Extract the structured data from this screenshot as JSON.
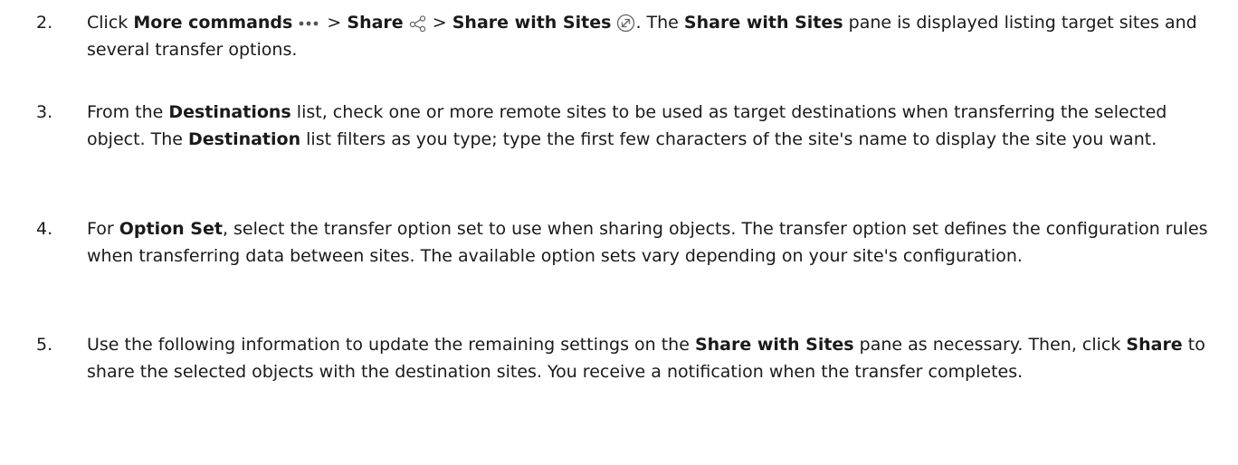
{
  "steps": [
    {
      "number": "2.",
      "t1": "Click ",
      "b1": "More commands",
      "t2": " > ",
      "b2": "Share",
      "t3": " > ",
      "b3": "Share with Sites",
      "t4": ". The ",
      "b4": "Share with Sites",
      "t5": " pane is displayed listing target sites and several transfer options.",
      "icons": [
        "more-commands-icon",
        "share-icon",
        "share-with-sites-icon"
      ]
    },
    {
      "number": "3.",
      "t1": "From the ",
      "b1": "Destinations",
      "t2": " list, check one or more remote sites to be used as target destinations when transferring the selected object. The ",
      "b2": "Destination",
      "t3": " list filters as you type; type the first few characters of the site's name to display the site you want."
    },
    {
      "number": "4.",
      "t1": "For ",
      "b1": "Option Set",
      "t2": ", select the transfer option set to use when sharing objects. The transfer option set defines the configuration rules when transferring data between sites. The available option sets vary depending on your site's configuration."
    },
    {
      "number": "5.",
      "t1": "Use the following information to update the remaining settings on the ",
      "b1": "Share with Sites",
      "t2": " pane as necessary. Then, click ",
      "b2": "Share",
      "t3": " to share the selected objects with the destination sites. You receive a notification when the transfer completes."
    }
  ]
}
